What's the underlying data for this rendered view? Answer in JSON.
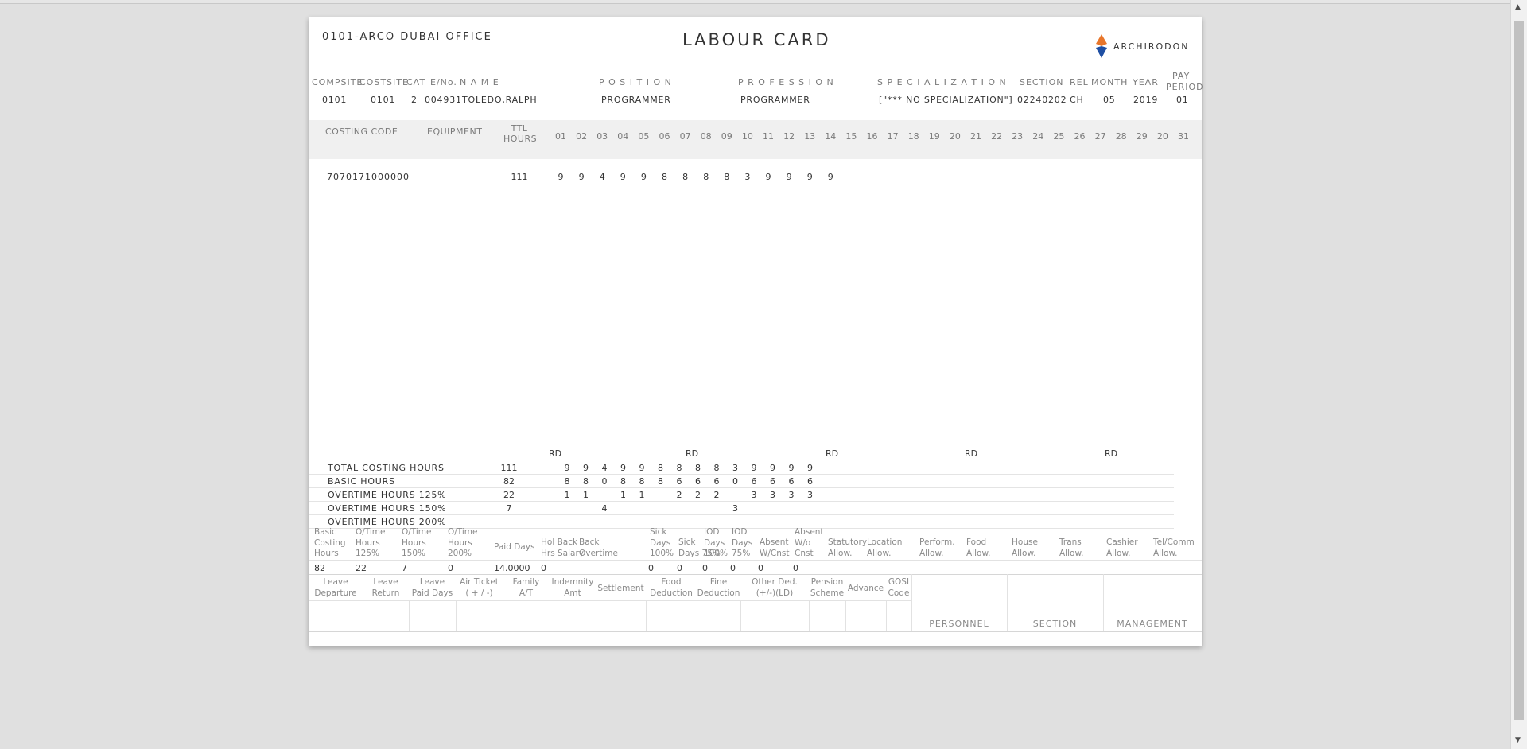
{
  "office": "0101-ARCO DUBAI OFFICE",
  "title": "LABOUR CARD",
  "brand": "ARCHIRODON",
  "colors": {
    "logo_orange": "#e8762b",
    "logo_blue": "#1f4fa3"
  },
  "employee_header": {
    "labels": [
      "COMPSITE",
      "COSTSITE",
      "CAT",
      "E/No.",
      "N A M E",
      "P O S I T I O N",
      "P R O F E S S I O N",
      "S P E C I A L I Z A T I O N",
      "SECTION",
      "REL",
      "MONTH",
      "YEAR",
      "PAY",
      "PERIOD"
    ],
    "values": [
      "0101",
      "0101",
      "2",
      "004931",
      "TOLEDO,RALPH",
      "PROGRAMMER",
      "PROGRAMMER",
      "[\"*** NO SPECIALIZATION\"]",
      "02240202",
      "CH",
      "05",
      "2019",
      "01"
    ]
  },
  "grid_header": {
    "costing_code": "COSTING CODE",
    "equipment": "EQUIPMENT",
    "ttl": "TTL",
    "hours": "HOURS",
    "days": [
      "01",
      "02",
      "03",
      "04",
      "05",
      "06",
      "07",
      "08",
      "09",
      "10",
      "11",
      "12",
      "13",
      "14",
      "15",
      "16",
      "17",
      "18",
      "19",
      "20",
      "21",
      "22",
      "23",
      "24",
      "25",
      "26",
      "27",
      "28",
      "29",
      "20",
      "31"
    ]
  },
  "costing_rows": [
    {
      "code": "7070171000000",
      "equipment": "",
      "total": "111",
      "days": [
        "9",
        "9",
        "4",
        "9",
        "9",
        "8",
        "8",
        "8",
        "8",
        "3",
        "9",
        "9",
        "9",
        "9"
      ]
    }
  ],
  "rest_days": [
    "RD",
    "RD",
    "RD",
    "RD",
    "RD"
  ],
  "summary": [
    {
      "label": "TOTAL COSTING HOURS",
      "total": "111",
      "days": [
        "9",
        "9",
        "4",
        "9",
        "9",
        "8",
        "8",
        "8",
        "8",
        "3",
        "9",
        "9",
        "9",
        "9"
      ]
    },
    {
      "label": "BASIC HOURS",
      "total": "82",
      "days": [
        "8",
        "8",
        "0",
        "8",
        "8",
        "8",
        "6",
        "6",
        "6",
        "0",
        "6",
        "6",
        "6",
        "6"
      ]
    },
    {
      "label": "OVERTIME HOURS 125%",
      "total": "22",
      "days": [
        "1",
        "1",
        "",
        "1",
        "1",
        "",
        "2",
        "2",
        "2",
        "",
        "3",
        "3",
        "3",
        "3"
      ]
    },
    {
      "label": "OVERTIME HOURS 150%",
      "total": "7",
      "days": [
        "",
        "",
        "4",
        "",
        "",
        "",
        "",
        "",
        "",
        "3",
        "",
        "",
        "",
        ""
      ]
    },
    {
      "label": "OVERTIME HOURS 200%",
      "total": "",
      "days": []
    }
  ],
  "payroll": {
    "headers": [
      [
        "Basic",
        "Costing",
        "Hours"
      ],
      [
        "O/Time",
        "Hours",
        "125%"
      ],
      [
        "O/Time",
        "Hours",
        "150%"
      ],
      [
        "O/Time",
        "Hours",
        "200%"
      ],
      [
        "Paid Days"
      ],
      [
        "Hol Back",
        "Hrs Salary"
      ],
      [
        "Back",
        "Overtime"
      ],
      [
        "Sick",
        "Days",
        "100%"
      ],
      [
        "Sick",
        "Days 75%"
      ],
      [
        "IOD",
        "Days",
        "100%"
      ],
      [
        "IOD",
        "Days",
        "75%"
      ],
      [
        "Absent",
        "W/Cnst"
      ],
      [
        "Absent",
        "W/o",
        "Cnst"
      ],
      [
        "Statutory",
        "Allow."
      ],
      [
        "Location",
        "Allow."
      ],
      [
        "Perform.",
        "Allow."
      ],
      [
        "Food",
        "Allow."
      ],
      [
        "House",
        "Allow."
      ],
      [
        "Trans",
        "Allow."
      ],
      [
        "Cashier",
        "Allow."
      ],
      [
        "Tel/Comm",
        "Allow."
      ]
    ],
    "values": [
      "82",
      "22",
      "7",
      "0",
      "14.0000",
      "0",
      "",
      "0",
      "0",
      "0",
      "0",
      "0",
      "0"
    ]
  },
  "deductions": {
    "headers": [
      [
        "Leave",
        "Departure"
      ],
      [
        "Leave",
        "Return"
      ],
      [
        "Leave",
        "Paid Days"
      ],
      [
        "Air Ticket",
        "( + / -)"
      ],
      [
        "Family",
        "A/T"
      ],
      [
        "Indemnity",
        "Amt"
      ],
      [
        "Settlement"
      ],
      [
        "Food",
        "Deduction"
      ],
      [
        "Fine",
        "Deduction"
      ],
      [
        "Other Ded.",
        "(+/-)(LD)"
      ],
      [
        "Pension",
        "Scheme"
      ],
      [
        "Advance"
      ],
      [
        "GOSI",
        "Code"
      ]
    ]
  },
  "signatures": [
    "PERSONNEL",
    "SECTION",
    "MANAGEMENT"
  ]
}
